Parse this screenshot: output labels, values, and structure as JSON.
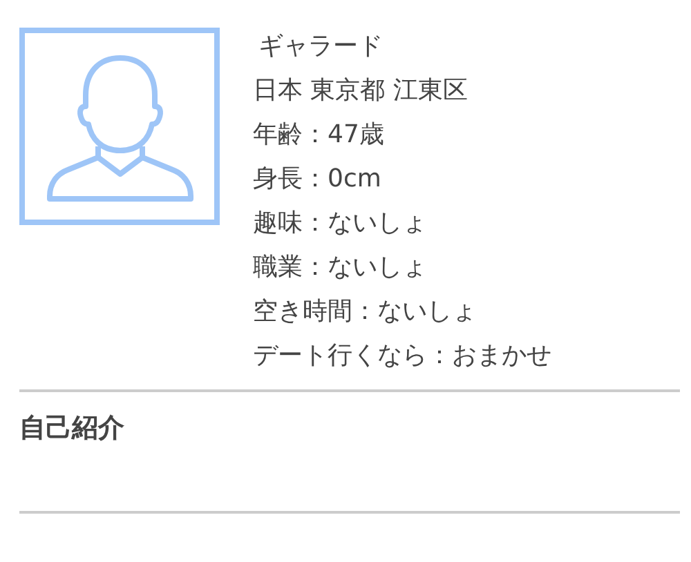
{
  "profile": {
    "name": "ギャラード",
    "details": [
      "日本 東京都 江東区",
      "年齢：47歳",
      "身長：0cm",
      "趣味：ないしょ",
      "職業：ないしょ",
      "空き時間：ないしょ",
      "デート行くなら：おまかせ"
    ]
  },
  "section": {
    "title": "自己紹介"
  }
}
